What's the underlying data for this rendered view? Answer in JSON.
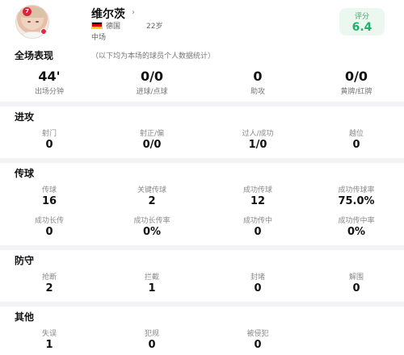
{
  "player": {
    "jersey_number": "7",
    "name": "维尔茨",
    "chevron": "›",
    "country": "德国",
    "age": "22岁",
    "position": "中场",
    "flag_colors": [
      "#000000",
      "#DD0000",
      "#FFCE00"
    ]
  },
  "rating": {
    "label": "评分",
    "value": "6.4"
  },
  "overview": {
    "title": "全场表现",
    "note": "（以下均为本场的球员个人数据统计）",
    "stats": [
      {
        "value": "44'",
        "label": "出场分钟"
      },
      {
        "value": "0/0",
        "label": "进球/点球"
      },
      {
        "value": "0",
        "label": "助攻"
      },
      {
        "value": "0/0",
        "label": "黄牌/红牌"
      }
    ]
  },
  "attack": {
    "title": "进攻",
    "stats": [
      {
        "label": "射门",
        "value": "0"
      },
      {
        "label": "射正/偏",
        "value": "0/0"
      },
      {
        "label": "过人/成功",
        "value": "1/0"
      },
      {
        "label": "越位",
        "value": "0"
      }
    ]
  },
  "passing": {
    "title": "传球",
    "row1": [
      {
        "label": "传球",
        "value": "16"
      },
      {
        "label": "关键传球",
        "value": "2"
      },
      {
        "label": "成功传球",
        "value": "12"
      },
      {
        "label": "成功传球率",
        "value": "75.0%"
      }
    ],
    "row2": [
      {
        "label": "成功长传",
        "value": "0"
      },
      {
        "label": "成功长传率",
        "value": "0%"
      },
      {
        "label": "成功传中",
        "value": "0"
      },
      {
        "label": "成功传中率",
        "value": "0%"
      }
    ]
  },
  "defense": {
    "title": "防守",
    "stats": [
      {
        "label": "抢断",
        "value": "2"
      },
      {
        "label": "拦截",
        "value": "1"
      },
      {
        "label": "封堵",
        "value": "0"
      },
      {
        "label": "解围",
        "value": "0"
      }
    ]
  },
  "other": {
    "title": "其他",
    "stats": [
      {
        "label": "失误",
        "value": "1"
      },
      {
        "label": "犯规",
        "value": "0"
      },
      {
        "label": "被侵犯",
        "value": "0"
      }
    ]
  },
  "colors": {
    "rating_green": "#19B36A",
    "jersey_red": "#D3263A",
    "divider_gray": "#F3F3F5"
  }
}
